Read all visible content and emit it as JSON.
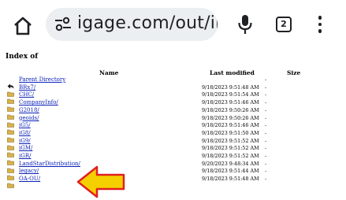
{
  "browser": {
    "url_text": "igage.com/out/ii",
    "tab_count": "2",
    "icons": [
      "home-icon",
      "site-settings-icon",
      "microphone-icon",
      "tabs-icon",
      "more-vert-icon"
    ]
  },
  "page": {
    "title": "Index of",
    "columns": {
      "name": "Name",
      "modified": "Last modified",
      "size": "Size"
    },
    "entries": [
      {
        "name": "Parent Directory",
        "modified": "",
        "size": "-",
        "icon": "back-icon"
      },
      {
        "name": "BRx7/",
        "modified": "9/18/2023 9:51:48 AM",
        "size": "-",
        "icon": "folder-icon"
      },
      {
        "name": "CHC/",
        "modified": "9/18/2023 9:51:54 AM",
        "size": "-",
        "icon": "folder-icon"
      },
      {
        "name": "CompanyInfo/",
        "modified": "9/18/2023 9:51:46 AM",
        "size": "-",
        "icon": "folder-icon"
      },
      {
        "name": "G2018/",
        "modified": "9/18/2023 9:50:26 AM",
        "size": "-",
        "icon": "folder-icon"
      },
      {
        "name": "geoids/",
        "modified": "9/18/2023 9:50:26 AM",
        "size": "-",
        "icon": "folder-icon"
      },
      {
        "name": "iG5/",
        "modified": "9/18/2023 9:51:46 AM",
        "size": "-",
        "icon": "folder-icon"
      },
      {
        "name": "iG8/",
        "modified": "9/18/2023 9:51:50 AM",
        "size": "-",
        "icon": "folder-icon"
      },
      {
        "name": "iG9/",
        "modified": "9/18/2023 9:51:52 AM",
        "size": "-",
        "icon": "folder-icon"
      },
      {
        "name": "iGM/",
        "modified": "9/18/2023 9:51:52 AM",
        "size": "-",
        "icon": "folder-icon"
      },
      {
        "name": "iGR/",
        "modified": "9/18/2023 9:51:52 AM",
        "size": "-",
        "icon": "folder-icon"
      },
      {
        "name": "LandStarDistribution/",
        "modified": "9/20/2023 9:48:34 AM",
        "size": "-",
        "icon": "folder-icon"
      },
      {
        "name": "legacy/",
        "modified": "9/18/2023 9:51:44 AM",
        "size": "-",
        "icon": "folder-icon"
      },
      {
        "name": "OA-OU/",
        "modified": "9/18/2023 9:51:48 AM",
        "size": "-",
        "icon": "folder-icon"
      }
    ]
  },
  "annotation": {
    "arrow_color": "#f4d000",
    "arrow_outline": "#e02020"
  }
}
